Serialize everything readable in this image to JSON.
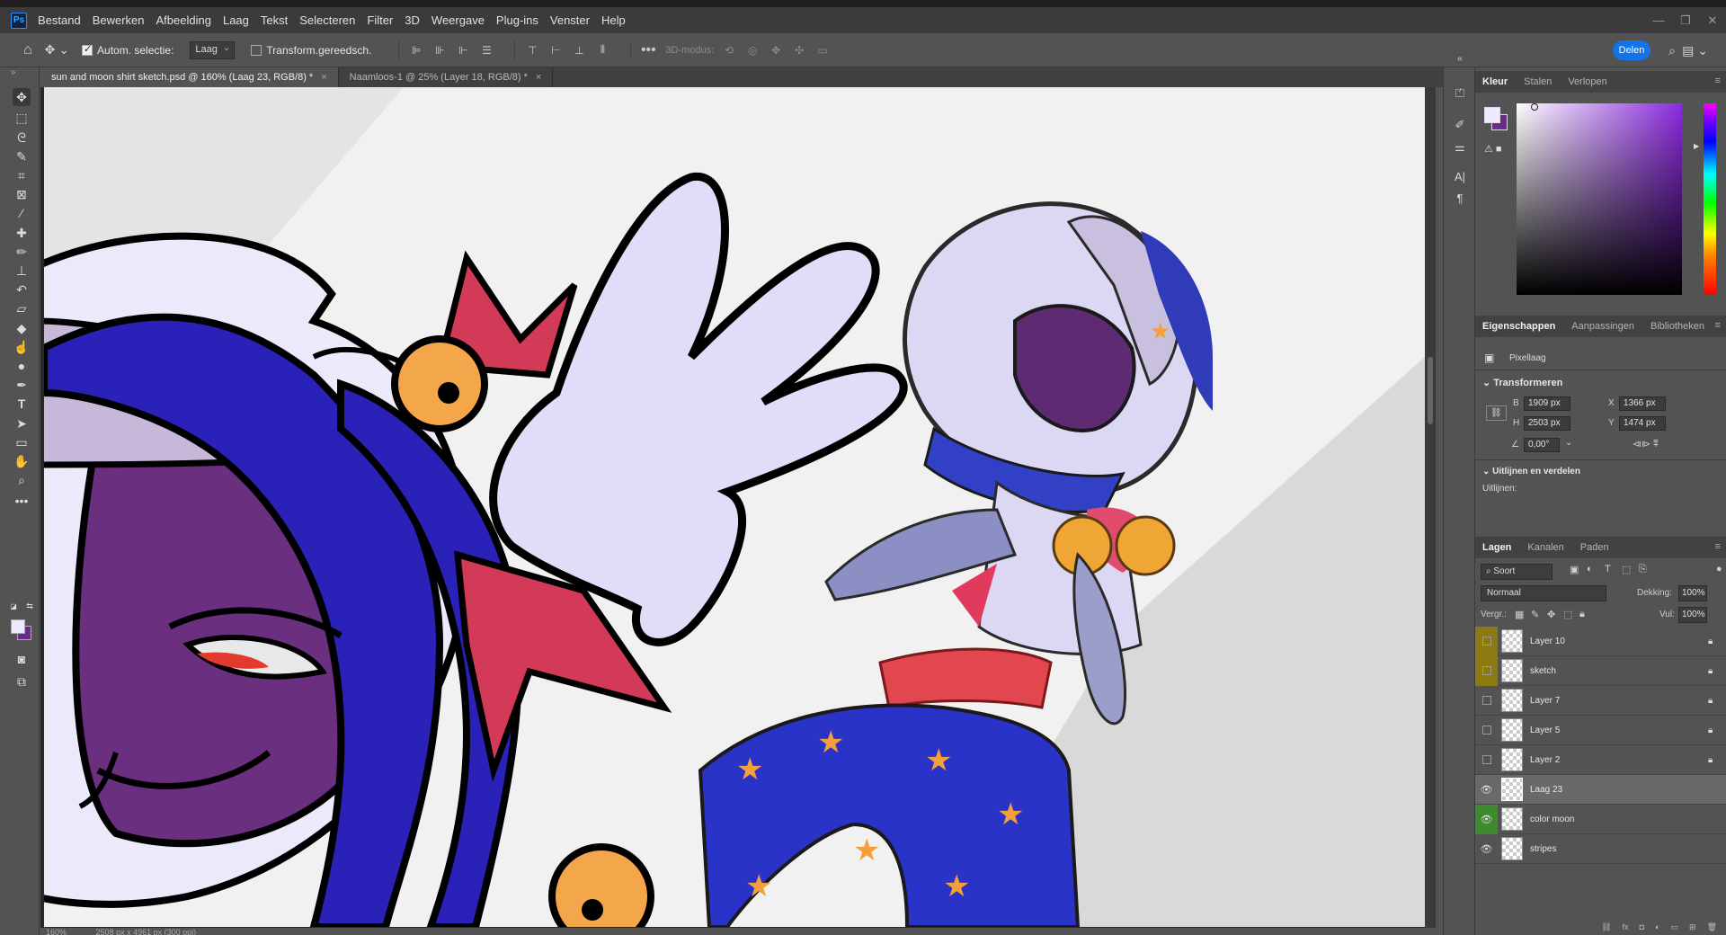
{
  "menubar": {
    "logo": "Ps",
    "items": [
      "Bestand",
      "Bewerken",
      "Afbeelding",
      "Laag",
      "Tekst",
      "Selecteren",
      "Filter",
      "3D",
      "Weergave",
      "Plug-ins",
      "Venster",
      "Help"
    ]
  },
  "options": {
    "auto_select_label": "Autom. selectie:",
    "auto_select_value": "Laag",
    "transform_label": "Transform.gereedsch.",
    "mode_3d": "3D-modus:",
    "share_label": "Delen"
  },
  "doc_tabs": [
    {
      "label": "sun and moon shirt sketch.psd @ 160% (Laag 23, RGB/8) *",
      "active": true
    },
    {
      "label": "Naamloos-1 @ 25% (Layer 18, RGB/8) *",
      "active": false
    }
  ],
  "colors": {
    "foreground": "#ede9ff",
    "background": "#6a2b8a",
    "accent": "#1473e6"
  },
  "color_panel": {
    "tabs": [
      "Kleur",
      "Stalen",
      "Verlopen"
    ]
  },
  "properties": {
    "tabs": [
      "Eigenschappen",
      "Aanpassingen",
      "Bibliotheken"
    ],
    "layer_type": "Pixellaag",
    "transform_title": "Transformeren",
    "w_label": "B",
    "w_value": "1909 px",
    "h_label": "H",
    "h_value": "2503 px",
    "x_label": "X",
    "x_value": "1366 px",
    "y_label": "Y",
    "y_value": "1474 px",
    "angle_value": "0,00°",
    "align_title": "Uitlijnen en verdelen",
    "align_label": "Uitlijnen:"
  },
  "layers": {
    "tabs": [
      "Lagen",
      "Kanalen",
      "Paden"
    ],
    "kind": "Soort",
    "blend_mode": "Normaal",
    "opacity_label": "Dekking:",
    "opacity_value": "100%",
    "lock_label": "Vergr.:",
    "fill_label": "Vul:",
    "fill_value": "100%",
    "items": [
      {
        "name": "Layer 10",
        "visible": false,
        "color": "yellow",
        "locked": true
      },
      {
        "name": "sketch",
        "visible": false,
        "color": "yellow",
        "locked": true
      },
      {
        "name": "Layer 7",
        "visible": false,
        "color": "none",
        "locked": true
      },
      {
        "name": "Layer 5",
        "visible": false,
        "color": "none",
        "locked": true
      },
      {
        "name": "Layer 2",
        "visible": false,
        "color": "none",
        "locked": true
      },
      {
        "name": "Laag 23",
        "visible": true,
        "color": "none",
        "locked": false,
        "selected": true
      },
      {
        "name": "color moon",
        "visible": true,
        "color": "green",
        "locked": false
      },
      {
        "name": "stripes",
        "visible": true,
        "color": "none",
        "locked": false
      }
    ]
  },
  "status": {
    "zoom": "160%",
    "doc_size": "2508 px x 4961 px (300 ppi)"
  }
}
